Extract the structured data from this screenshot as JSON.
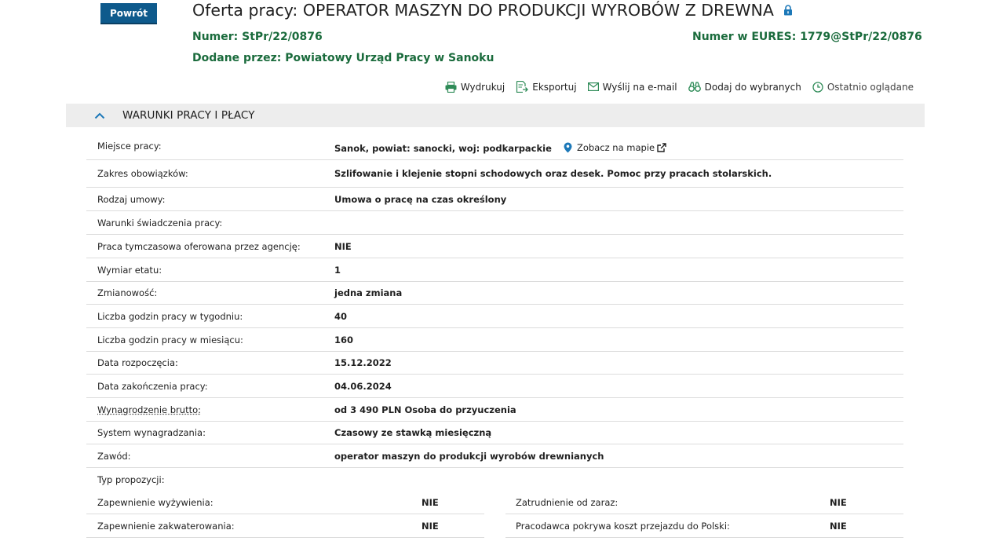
{
  "header": {
    "back_label": "Powrót",
    "title": "Oferta pracy: OPERATOR MASZYN DO PRODUKCJI WYROBÓW Z DREWNA",
    "number_label": "Numer:",
    "number_value": "StPr/22/0876",
    "eures_label": "Numer w EURES:",
    "eures_value": "1779@StPr/22/0876",
    "added_label": "Dodane przez:",
    "added_value": "Powiatowy Urząd Pracy w Sanoku"
  },
  "toolbar": {
    "print": "Wydrukuj",
    "export": "Eksportuj",
    "email": "Wyślij na e-mail",
    "favorites": "Dodaj do wybranych",
    "recent": "Ostatnio oglądane"
  },
  "section": {
    "title": "WARUNKI PRACY I PŁACY",
    "map_link": "Zobacz na mapie",
    "rows": [
      {
        "label": "Miejsce pracy:",
        "value": "Sanok, powiat: sanocki, woj: podkarpackie"
      },
      {
        "label": "Zakres obowiązków:",
        "value": "Szlifowanie i klejenie stopni schodowych oraz desek. Pomoc przy pracach stolarskich."
      },
      {
        "label": "Rodzaj umowy:",
        "value": "Umowa o pracę na czas określony"
      },
      {
        "label": "Warunki świadczenia pracy:",
        "value": ""
      },
      {
        "label": "Praca tymczasowa oferowana przez agencję:",
        "value": "NIE"
      },
      {
        "label": "Wymiar etatu:",
        "value": "1"
      },
      {
        "label": "Zmianowość:",
        "value": "jedna zmiana"
      },
      {
        "label": "Liczba godzin pracy w tygodniu:",
        "value": "40"
      },
      {
        "label": "Liczba godzin pracy w miesiącu:",
        "value": "160"
      },
      {
        "label": "Data rozpoczęcia:",
        "value": "15.12.2022"
      },
      {
        "label": "Data zakończenia pracy:",
        "value": "04.06.2024"
      },
      {
        "label": "Wynagrodzenie brutto:",
        "value": "od 3 490 PLN Osoba do przyuczenia"
      },
      {
        "label": "System wynagradzania:",
        "value": "Czasowy ze stawką miesięczną"
      },
      {
        "label": "Zawód:",
        "value": "operator maszyn do produkcji wyrobów drewnianych"
      },
      {
        "label": "Typ propozycji:",
        "value": ""
      }
    ],
    "grid": [
      {
        "left_label": "Zapewnienie wyżywienia:",
        "left_value": "NIE",
        "right_label": "Zatrudnienie od zaraz:",
        "right_value": "NIE"
      },
      {
        "left_label": "Zapewnienie zakwaterowania:",
        "left_value": "NIE",
        "right_label": "Pracodawca pokrywa koszt przejazdu do Polski:",
        "right_value": "NIE"
      }
    ]
  },
  "colors": {
    "primary_button": "#0e5a8c",
    "green_text": "#1a6b3c",
    "icon_green": "#2e8b57",
    "icon_blue": "#1c78b8",
    "section_bg": "#ededed"
  }
}
